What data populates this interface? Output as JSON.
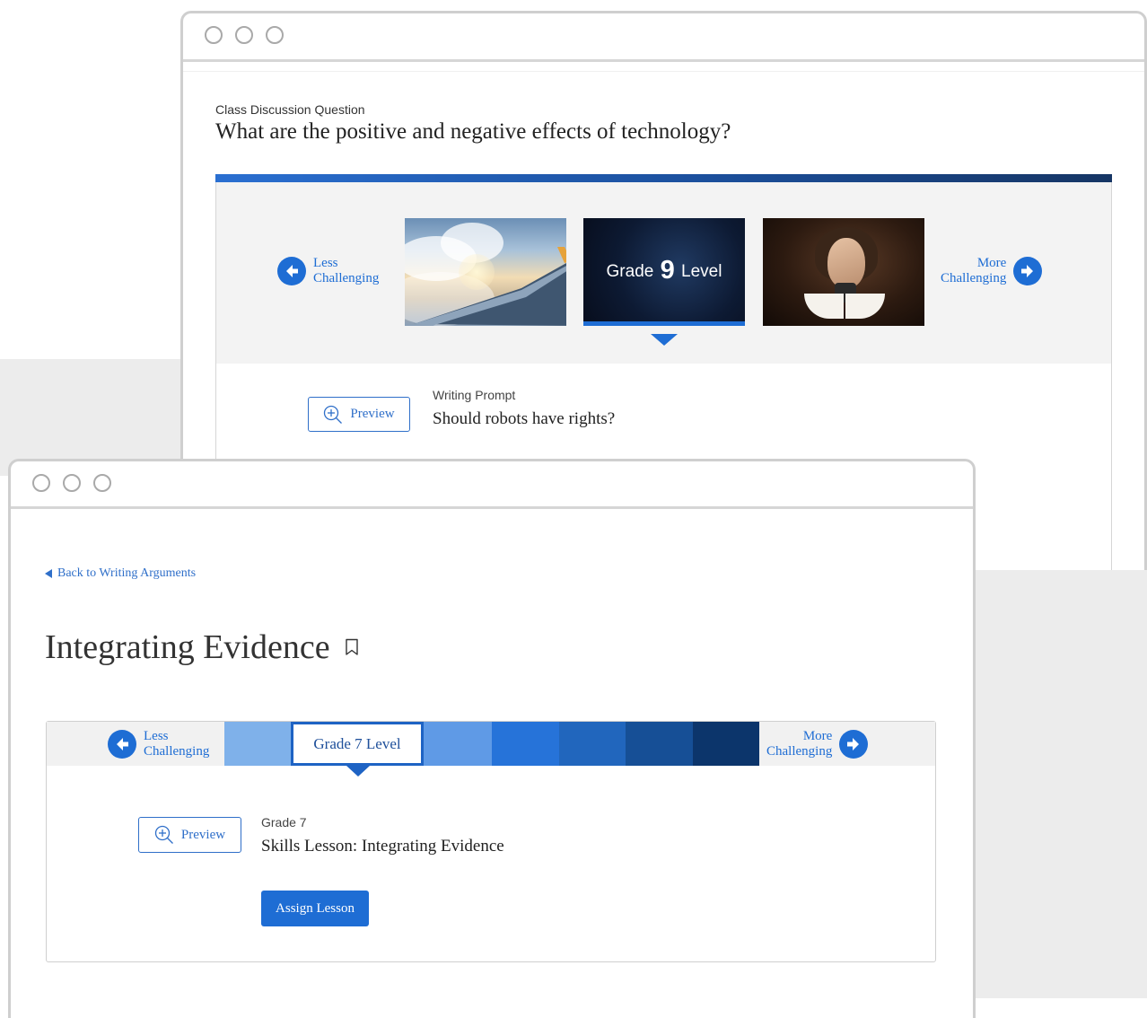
{
  "top_window": {
    "question_label": "Class Discussion Question",
    "question_title": "What are the positive and negative effects of technology?",
    "less_line1": "Less",
    "less_line2": "Challenging",
    "more_line1": "More",
    "more_line2": "Challenging",
    "grade_prefix": "Grade",
    "grade_number": "9",
    "grade_suffix": "Level",
    "preview_label": "Preview",
    "prompt_label": "Writing Prompt",
    "prompt_title": "Should robots have rights?"
  },
  "bottom_window": {
    "back_link": "Back to Writing Arguments",
    "page_title": "Integrating Evidence",
    "less_line1": "Less",
    "less_line2": "Challenging",
    "more_line1": "More",
    "more_line2": "Challenging",
    "active_level": "Grade 7 Level",
    "preview_label": "Preview",
    "grade_label": "Grade 7",
    "lesson_title": "Skills Lesson: Integrating Evidence",
    "assign_button": "Assign Lesson"
  },
  "colors": {
    "accent": "#1e6dd4",
    "level_segments": [
      "#7fb1ea",
      "#1e63c4",
      "#5f9ae6",
      "#2673d9",
      "#2166bd",
      "#164f96",
      "#0c356b"
    ]
  }
}
